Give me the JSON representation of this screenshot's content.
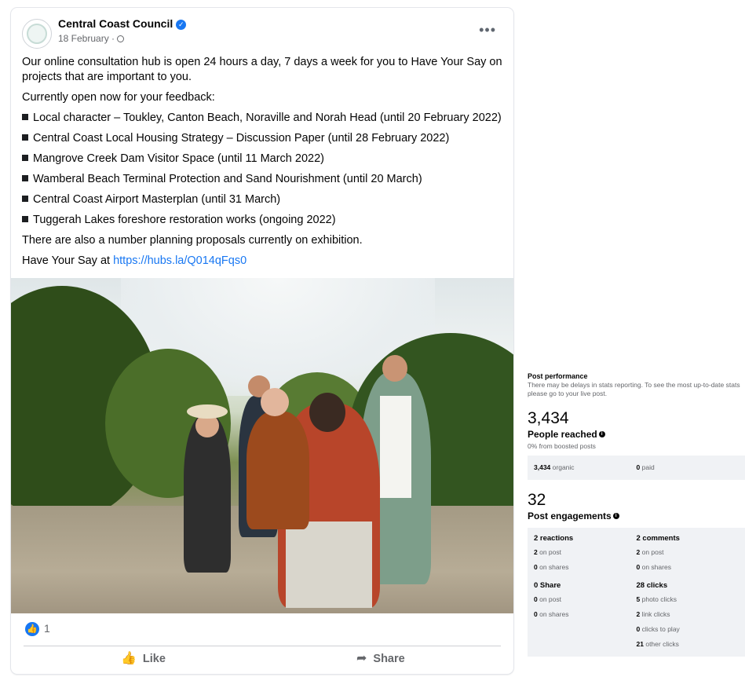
{
  "post": {
    "page_name": "Central Coast Council",
    "date": "18 February ·",
    "paragraphs": [
      "Our online consultation hub is open 24 hours a day, 7 days a week for you to Have Your Say on projects that are important to you.",
      "Currently open now for your feedback:"
    ],
    "bullets": [
      "Local character – Toukley, Canton Beach, Noraville and Norah Head (until 20 February 2022)",
      "Central Coast Local Housing Strategy – Discussion Paper (until 28 February 2022)",
      "Mangrove Creek Dam Visitor Space (until 11 March 2022)",
      "Wamberal Beach Terminal Protection and Sand Nourishment (until 20 March)",
      "Central Coast Airport Masterplan (until 31 March)",
      "Tuggerah Lakes foreshore restoration works (ongoing 2022)"
    ],
    "closing": "There are also a number planning proposals currently on exhibition.",
    "cta_prefix": "Have Your Say at ",
    "cta_link": "https://hubs.la/Q014qFqs0",
    "reaction_count": "1",
    "like_label": "Like",
    "share_label": "Share"
  },
  "insights": {
    "title": "Post performance",
    "note": "There may be delays in stats reporting. To see the most up-to-date stats please go to your live post.",
    "reach_value": "3,434",
    "reach_label": "People reached",
    "reach_sub": "0% from boosted posts",
    "organic_value": "3,434",
    "organic_label": "organic",
    "paid_value": "0",
    "paid_label": "paid",
    "engagement_value": "32",
    "engagement_label": "Post engagements",
    "reactions_h": "2 reactions",
    "reactions_post_v": "2",
    "reactions_post_l": "on post",
    "reactions_share_v": "0",
    "reactions_share_l": "on shares",
    "comments_h": "2 comments",
    "comments_post_v": "2",
    "comments_post_l": "on post",
    "comments_share_v": "0",
    "comments_share_l": "on shares",
    "share_h": "0 Share",
    "share_post_v": "0",
    "share_post_l": "on post",
    "share_share_v": "0",
    "share_share_l": "on shares",
    "clicks_h": "28 clicks",
    "photo_clicks_v": "5",
    "photo_clicks_l": "photo clicks",
    "link_clicks_v": "2",
    "link_clicks_l": "link clicks",
    "play_clicks_v": "0",
    "play_clicks_l": "clicks to play",
    "other_clicks_v": "21",
    "other_clicks_l": "other clicks"
  }
}
